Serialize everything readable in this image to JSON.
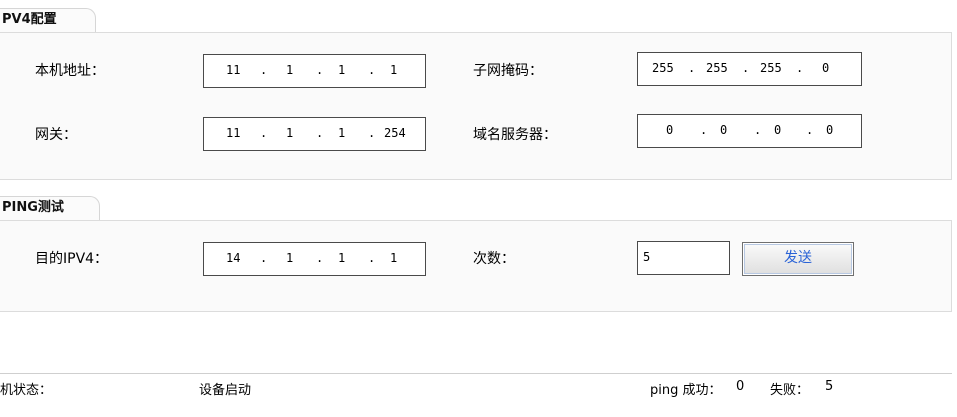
{
  "ipv4": {
    "tab_label": "PV4配置",
    "local_address": {
      "label": "本机地址：",
      "octets": [
        "11",
        "1",
        "1",
        "1"
      ]
    },
    "subnet_mask": {
      "label": "子网掩码：",
      "octets": [
        "255",
        "255",
        "255",
        "0"
      ]
    },
    "gateway": {
      "label": "网关：",
      "octets": [
        "11",
        "1",
        "1",
        "254"
      ]
    },
    "dns_server": {
      "label": "域名服务器：",
      "octets": [
        "0",
        "0",
        "0",
        "0"
      ]
    },
    "octet_separator": "."
  },
  "ping": {
    "tab_label": "PING测试",
    "target": {
      "label": "目的IPV4：",
      "octets": [
        "14",
        "1",
        "1",
        "1"
      ]
    },
    "count": {
      "label": "次数：",
      "value": "5"
    },
    "send_button": "发送"
  },
  "status": {
    "label": "机状态：",
    "value": "设备启动",
    "ping_success_label": "ping 成功：",
    "ping_success_value": "0",
    "ping_fail_label": "失败：",
    "ping_fail_value": "5"
  }
}
